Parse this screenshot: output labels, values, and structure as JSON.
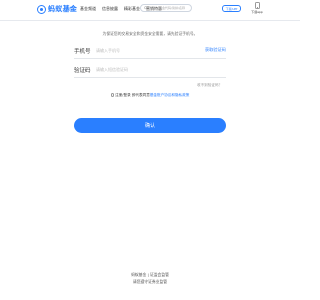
{
  "header": {
    "logo_text": "蚂蚁基金",
    "nav": [
      "首页",
      "基金频道",
      "信息披露",
      "精彩基金",
      "营销特惠"
    ],
    "search_placeholder": "请输入基金代码/简拼/名称",
    "app_button": "下载APP",
    "download_label": "下载app"
  },
  "notice": "为保证您的交易安全和资金安全需要，请先验证手机号。",
  "form": {
    "phone_label": "手机号",
    "phone_placeholder": "请输入手机号",
    "get_code": "获取验证码",
    "code_label": "验证码",
    "code_placeholder": "请输入短信验证码",
    "voice_tip": "收不到验证码？",
    "agree_prefix": "注册/登录 即代表同意",
    "agree_link": "基金账户协议和隐私政策",
    "confirm_button": "确认"
  },
  "footer": {
    "line1": "蚂蚁基金 | 证监会监管",
    "line2": "请您遵守证券业监管"
  },
  "colors": {
    "accent": "#2a7fff"
  }
}
